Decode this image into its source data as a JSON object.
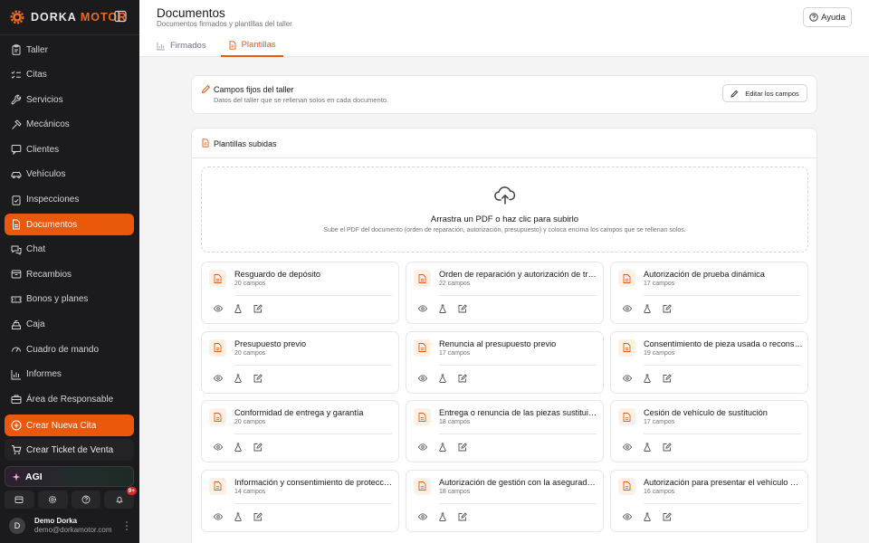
{
  "brand": {
    "name_part1": "DORKA",
    "name_part2": "MOTOR"
  },
  "sidebar": {
    "items": [
      {
        "label": "Taller",
        "icon": "clipboard-icon"
      },
      {
        "label": "Citas",
        "icon": "checklist-icon"
      },
      {
        "label": "Servicios",
        "icon": "wrench-icon"
      },
      {
        "label": "Mecánicos",
        "icon": "hammer-icon"
      },
      {
        "label": "Clientes",
        "icon": "message-square-icon"
      },
      {
        "label": "Vehículos",
        "icon": "car-icon"
      },
      {
        "label": "Inspecciones",
        "icon": "clipboard-check-icon"
      },
      {
        "label": "Documentos",
        "icon": "document-icon",
        "active": true
      },
      {
        "label": "Chat",
        "icon": "chat-icon"
      },
      {
        "label": "Recambios",
        "icon": "box-icon"
      },
      {
        "label": "Bonos y planes",
        "icon": "ticket-icon"
      },
      {
        "label": "Caja",
        "icon": "cash-register-icon"
      },
      {
        "label": "Cuadro de mando",
        "icon": "gauge-icon"
      },
      {
        "label": "Informes",
        "icon": "bar-chart-icon"
      },
      {
        "label": "Área de Responsable",
        "icon": "briefcase-icon"
      }
    ],
    "cta_new_appointment": "Crear Nueva Cita",
    "cta_ticket": "Crear Ticket de Venta",
    "agi": "AGI",
    "notification_badge": "9+",
    "user": {
      "initial": "D",
      "name": "Demo Dorka",
      "email": "demo@dorkamotor.com"
    }
  },
  "header": {
    "title": "Documentos",
    "subtitle": "Documentos firmados y plantillas del taller",
    "help": "Ayuda",
    "tabs": [
      {
        "label": "Firmados",
        "active": false
      },
      {
        "label": "Plantillas",
        "active": true
      }
    ]
  },
  "fixed_fields": {
    "title": "Campos fijos del taller",
    "description": "Datos del taller que se rellenan solos en cada documento.",
    "edit_button": "Editar los campos"
  },
  "templates": {
    "title": "Plantillas subidas",
    "dropzone_title": "Arrastra un PDF o haz clic para subirlo",
    "dropzone_sub": "Sube el PDF del documento (orden de reparación, autorización, presupuesto) y coloca encima los campos que se rellenan solos.",
    "items": [
      {
        "name": "Resguardo de depósito",
        "count": "20 campos"
      },
      {
        "name": "Orden de reparación y autorización de trabajos",
        "count": "22 campos"
      },
      {
        "name": "Autorización de prueba dinámica",
        "count": "17 campos"
      },
      {
        "name": "Presupuesto previo",
        "count": "20 campos"
      },
      {
        "name": "Renuncia al presupuesto previo",
        "count": "17 campos"
      },
      {
        "name": "Consentimiento de pieza usada o reconstruida",
        "count": "19 campos"
      },
      {
        "name": "Conformidad de entrega y garantía",
        "count": "20 campos"
      },
      {
        "name": "Entrega o renuncia de las piezas sustituidas",
        "count": "18 campos"
      },
      {
        "name": "Cesión de vehículo de sustitución",
        "count": "17 campos"
      },
      {
        "name": "Información y consentimiento de protección de datos",
        "count": "14 campos"
      },
      {
        "name": "Autorización de gestión con la aseguradora",
        "count": "18 campos"
      },
      {
        "name": "Autorización para presentar el vehículo a la ITV",
        "count": "16 campos"
      }
    ]
  },
  "colors": {
    "accent": "#ea580c",
    "sidebar_bg": "#1b1b1d",
    "page_bg": "#f4f4f5"
  }
}
